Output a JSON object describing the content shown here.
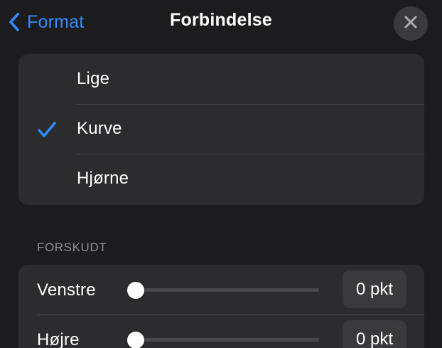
{
  "header": {
    "back_label": "Format",
    "title": "Forbindelse"
  },
  "connection_options": [
    {
      "label": "Lige",
      "selected": false
    },
    {
      "label": "Kurve",
      "selected": true
    },
    {
      "label": "Hjørne",
      "selected": false
    }
  ],
  "offset_section": {
    "title": "FORSKUDT",
    "rows": [
      {
        "label": "Venstre",
        "value": 0,
        "value_text": "0 pkt"
      },
      {
        "label": "Højre",
        "value": 0,
        "value_text": "0 pkt"
      }
    ]
  },
  "colors": {
    "accent": "#2f8cff",
    "background": "#1c1c1e",
    "group_background": "#2c2c2e"
  },
  "icons": {
    "back": "chevron-left-icon",
    "close": "close-icon",
    "check": "checkmark-icon"
  }
}
